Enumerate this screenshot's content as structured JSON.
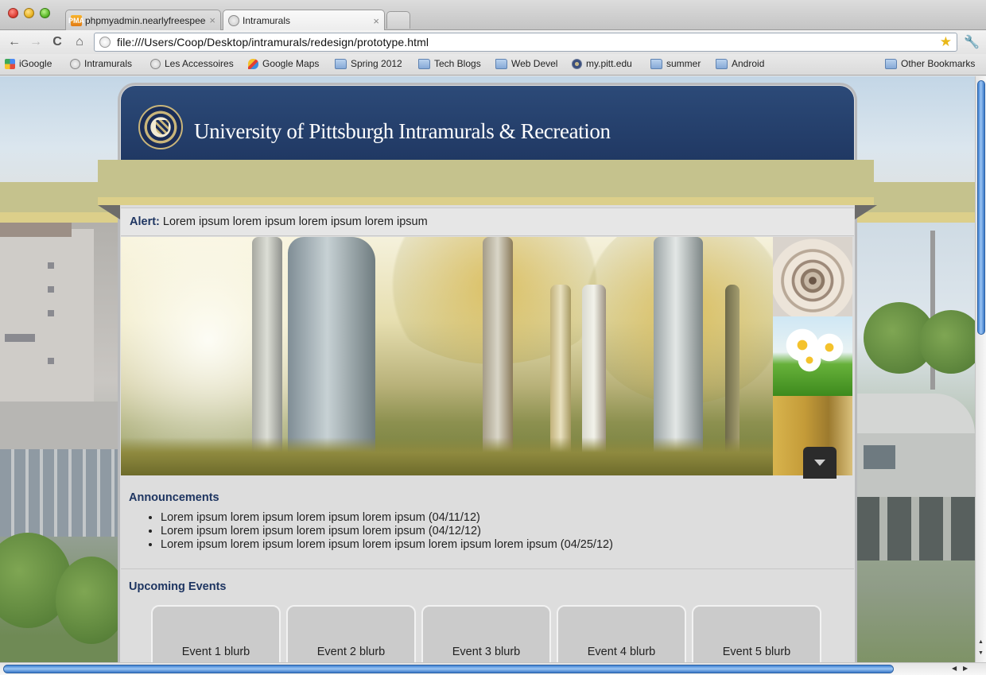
{
  "browser": {
    "tabs": [
      {
        "title": "phpmyadmin.nearlyfreespeech",
        "favicon": "phpmyadmin-icon",
        "favicon_text": "PMA"
      },
      {
        "title": "Intramurals",
        "favicon": "globe-icon"
      }
    ],
    "tab_close_glyph": "×",
    "url": "file:///Users/Coop/Desktop/intramurals/redesign/prototype.html",
    "bookmarks": [
      {
        "label": "iGoogle",
        "icon": "igoogle-icon"
      },
      {
        "label": "Intramurals",
        "icon": "globe-icon"
      },
      {
        "label": "Les Accessoires",
        "icon": "globe-icon"
      },
      {
        "label": "Google Maps",
        "icon": "google-maps-icon"
      },
      {
        "label": "Spring 2012",
        "icon": "folder-icon"
      },
      {
        "label": "Tech Blogs",
        "icon": "folder-icon"
      },
      {
        "label": "Web Devel",
        "icon": "folder-icon"
      },
      {
        "label": "my.pitt.edu",
        "icon": "pitt-icon"
      },
      {
        "label": "summer",
        "icon": "folder-icon"
      },
      {
        "label": "Android",
        "icon": "folder-icon"
      }
    ],
    "other_bookmarks": "Other Bookmarks",
    "glyphs": {
      "back": "←",
      "forward": "→",
      "reload": "C",
      "home": "⌂",
      "star": "★",
      "wrench": "🔧",
      "up": "▲",
      "down": "▼",
      "left": "◀",
      "right": "▶"
    }
  },
  "site": {
    "title": "University of Pittsburgh Intramurals & Recreation",
    "alert_label": "Alert:",
    "alert_text": "Lorem ipsum lorem ipsum lorem ipsum lorem ipsum",
    "announcements_title": "Announcements",
    "announcements": [
      "Lorem ipsum lorem ipsum lorem ipsum lorem ipsum (04/11/12)",
      "Lorem ipsum lorem ipsum lorem ipsum lorem ipsum (04/12/12)",
      "Lorem ipsum lorem ipsum lorem ipsum lorem ipsum lorem ipsum lorem ipsum (04/25/12)"
    ],
    "events_title": "Upcoming Events",
    "events": [
      "Event 1 blurb",
      "Event 2 blurb",
      "Event 3 blurb",
      "Event 4 blurb",
      "Event 5 blurb"
    ],
    "colors": {
      "header_navy": "#203863",
      "heading_navy": "#1e3561",
      "ribbon_olive": "#c5c28d",
      "ribbon_gold": "#dccf8a",
      "content_gray": "#dddddd"
    }
  }
}
